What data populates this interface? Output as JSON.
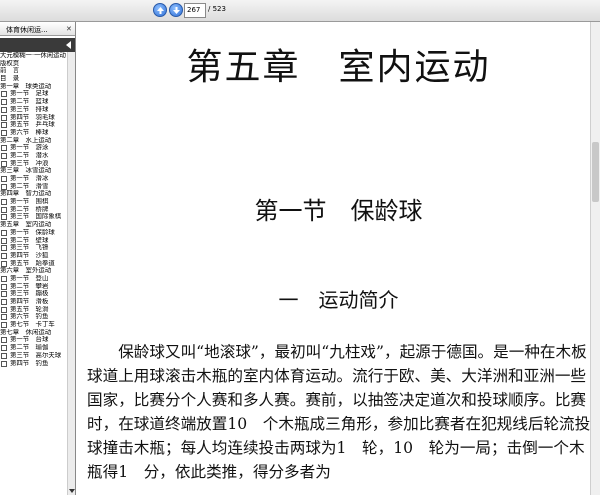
{
  "toolbar": {
    "page_current": "267",
    "page_total": "/ 523"
  },
  "sidebar": {
    "tab_label": "体育休闲运...",
    "tab_close": "✕",
    "items": [
      {
        "level": 0,
        "label": "大元模糊一·一休闲运动"
      },
      {
        "level": 0,
        "label": "版权页"
      },
      {
        "level": 0,
        "label": "前　言"
      },
      {
        "level": 0,
        "label": "目　录"
      },
      {
        "level": 0,
        "label": "第一章　球类运动"
      },
      {
        "level": 1,
        "label": "第一节　足球"
      },
      {
        "level": 1,
        "label": "第二节　篮球"
      },
      {
        "level": 1,
        "label": "第三节　排球"
      },
      {
        "level": 1,
        "label": "第四节　羽毛球"
      },
      {
        "level": 1,
        "label": "第五节　乒乓球"
      },
      {
        "level": 1,
        "label": "第六节　棒球"
      },
      {
        "level": 0,
        "label": "第二章　水上运动"
      },
      {
        "level": 1,
        "label": "第一节　游泳"
      },
      {
        "level": 1,
        "label": "第二节　潜水"
      },
      {
        "level": 1,
        "label": "第三节　冲浪"
      },
      {
        "level": 0,
        "label": "第三章　冰雪运动"
      },
      {
        "level": 1,
        "label": "第一节　滑冰"
      },
      {
        "level": 1,
        "label": "第二节　滑雪"
      },
      {
        "level": 0,
        "label": "第四章　智力运动"
      },
      {
        "level": 1,
        "label": "第一节　围棋"
      },
      {
        "level": 1,
        "label": "第二节　桥牌"
      },
      {
        "level": 1,
        "label": "第三节　国际象棋"
      },
      {
        "level": 0,
        "label": "第五章　室内运动"
      },
      {
        "level": 1,
        "label": "第一节　保龄球"
      },
      {
        "level": 1,
        "label": "第二节　壁球"
      },
      {
        "level": 1,
        "label": "第三节　飞镖"
      },
      {
        "level": 1,
        "label": "第四节　沙狐"
      },
      {
        "level": 1,
        "label": "第五节　跆拳道"
      },
      {
        "level": 0,
        "label": "第六章　室外运动"
      },
      {
        "level": 1,
        "label": "第一节　登山"
      },
      {
        "level": 1,
        "label": "第二节　攀岩"
      },
      {
        "level": 1,
        "label": "第三节　蹦极"
      },
      {
        "level": 1,
        "label": "第四节　滑板"
      },
      {
        "level": 1,
        "label": "第五节　轮滑"
      },
      {
        "level": 1,
        "label": "第六节　钓鱼"
      },
      {
        "level": 1,
        "label": "第七节　卡丁车"
      },
      {
        "level": 0,
        "label": "第七章　休闲运动"
      },
      {
        "level": 1,
        "label": "第一节　台球"
      },
      {
        "level": 1,
        "label": "第二节　瑜伽"
      },
      {
        "level": 1,
        "label": "第三节　高尔夫球"
      },
      {
        "level": 1,
        "label": "第四节　钓鱼"
      }
    ]
  },
  "document": {
    "chapter_title": "第五章　室内运动",
    "section_title": "第一节　保龄球",
    "sub_title": "一　运动简介",
    "body": "保龄球又叫“地滚球”，最初叫“九柱戏”，起源于德国。是一种在木板球道上用球滚击木瓶的室内体育运动。流行于欧、美、大洋洲和亚洲一些国家，比赛分个人赛和多人赛。赛前，以抽签决定道次和投球顺序。比赛时，在球道终端放置10　个木瓶成三角形，参加比赛者在犯规线后轮流投球撞击木瓶；每人均连续投击两球为1　轮，10　轮为一局；击倒一个木瓶得1　分，依此类推，得分多者为"
  }
}
